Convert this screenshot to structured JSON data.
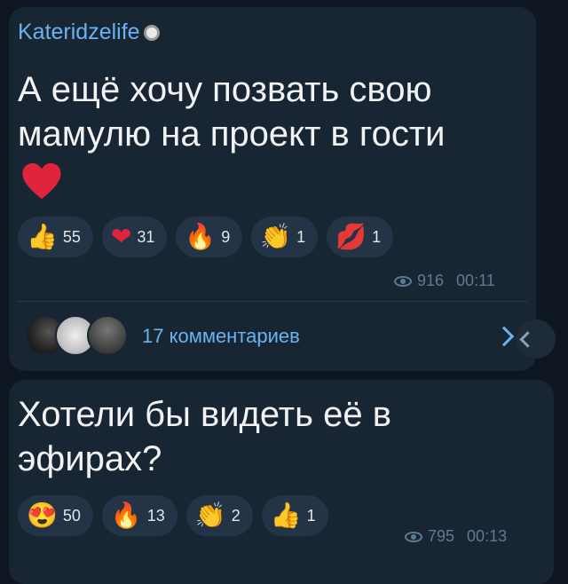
{
  "messages": [
    {
      "author": "Kateridzelife",
      "text": "А ещё хочу позвать свою мамулю на проект в гости",
      "text_emoji": "heart-emoji",
      "reactions": [
        {
          "emoji": "👍",
          "count": "55"
        },
        {
          "emoji": "❤",
          "count": "31"
        },
        {
          "emoji": "🔥",
          "count": "9"
        },
        {
          "emoji": "👏",
          "count": "1"
        },
        {
          "emoji": "💋",
          "count": "1"
        }
      ],
      "views": "916",
      "time": "00:11",
      "comments_label": "17 комментариев"
    },
    {
      "text": "Хотели бы видеть её в эфирах?",
      "reactions": [
        {
          "emoji": "😍",
          "count": "50"
        },
        {
          "emoji": "🔥",
          "count": "13"
        },
        {
          "emoji": "👏",
          "count": "2"
        },
        {
          "emoji": "👍",
          "count": "1"
        }
      ],
      "views": "795",
      "time": "00:13"
    }
  ],
  "colors": {
    "background": "#0e1621",
    "bubble": "#182533",
    "accent": "#6ab2f2",
    "meta": "#5e7b93"
  }
}
